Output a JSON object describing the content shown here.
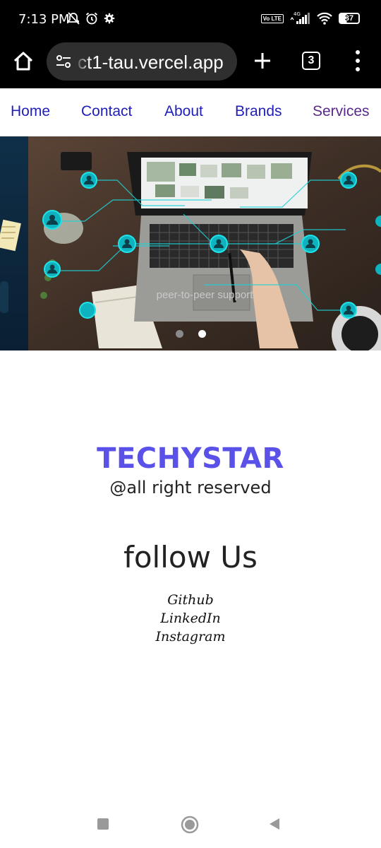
{
  "status_bar": {
    "time": "7:13 PM",
    "network": "4G",
    "volte": "Vo LTE",
    "battery": "37"
  },
  "browser": {
    "url": "ct1-tau.vercel.app",
    "tab_count": "3"
  },
  "nav": {
    "items": [
      "Home",
      "Contact",
      "About",
      "Brands",
      "Services"
    ]
  },
  "carousel": {
    "caption": "peer-to-peer support",
    "active_slide": 2,
    "slide_count": 2
  },
  "footer": {
    "brand": "TECHYSTAR",
    "rights": "@all right reserved",
    "follow_heading": "follow Us",
    "links": [
      "Github",
      "LinkedIn",
      "Instagram"
    ]
  },
  "colors": {
    "brand": "#5a52e8",
    "nav_link": "#1f1fb8",
    "nav_link_visited": "#5a2a8a"
  }
}
